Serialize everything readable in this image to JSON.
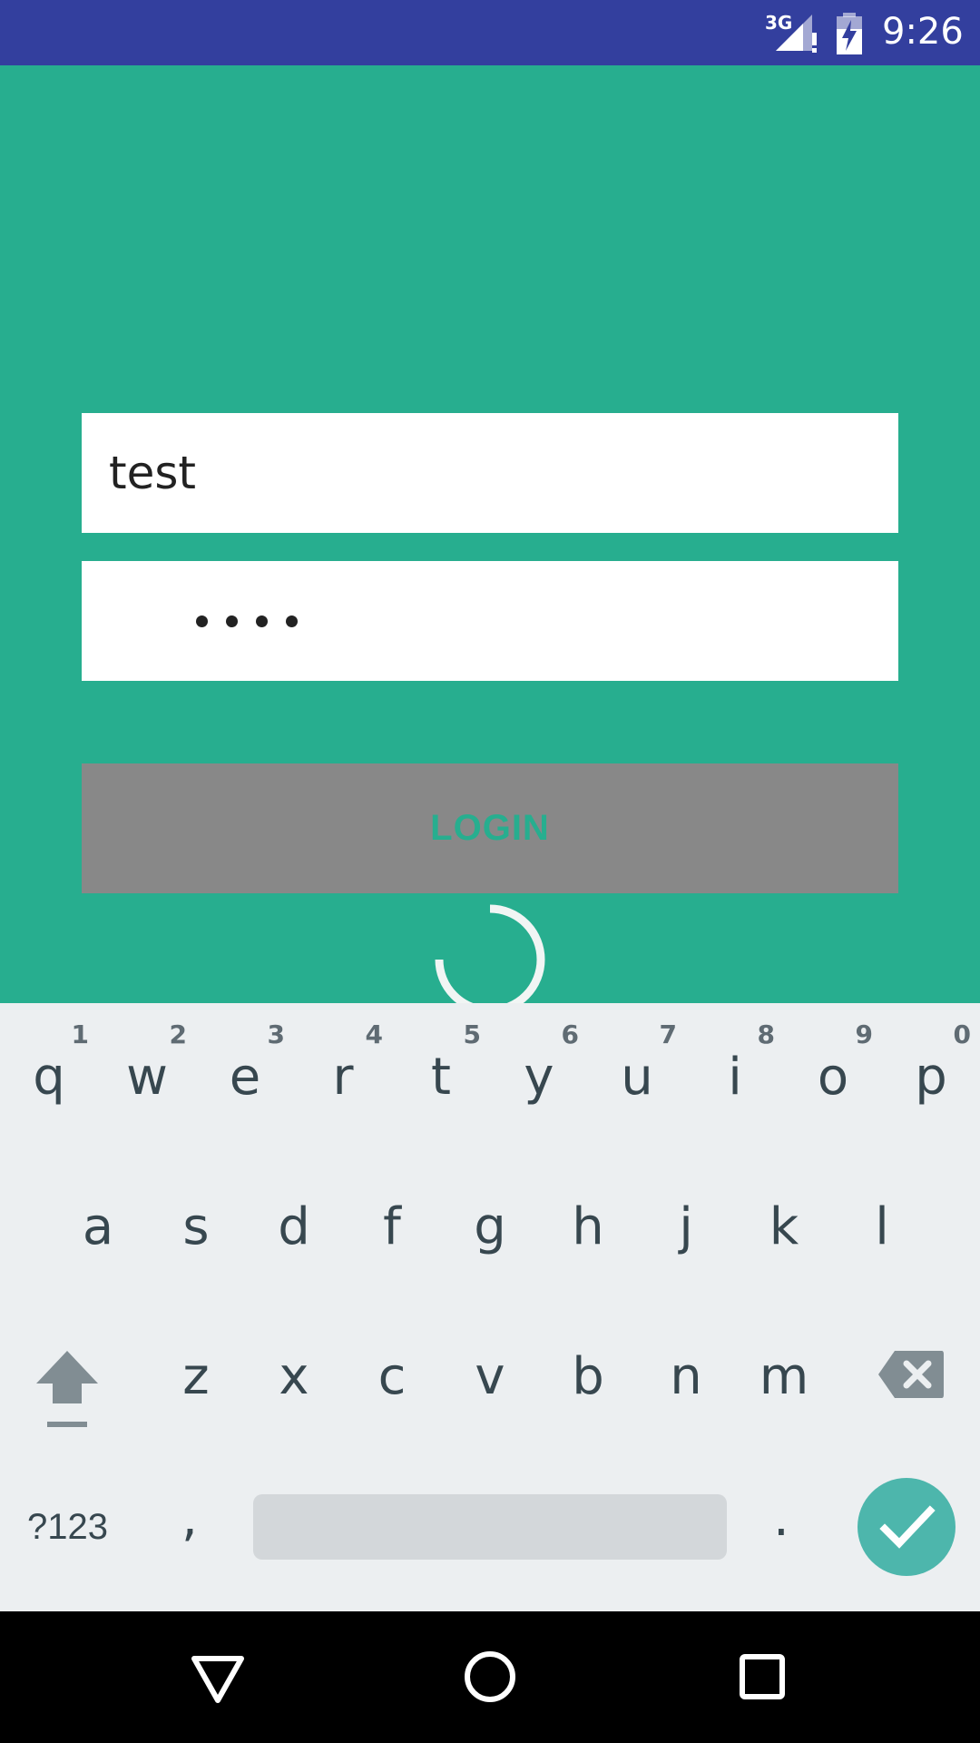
{
  "status_bar": {
    "network": "3G",
    "time": "9:26",
    "colors": {
      "background": "#333F9E",
      "icons": "#FFFFFF"
    },
    "icons": [
      "signal-icon",
      "battery-charging-icon"
    ]
  },
  "login": {
    "username_value": "test",
    "password_mask_count": 4,
    "login_label": "LOGIN",
    "colors": {
      "background": "#27AE8F",
      "button": "#888888",
      "button_text": "#27AE8F",
      "field": "#FFFFFF"
    }
  },
  "loading": {
    "icon": "loading-spinner-icon"
  },
  "keyboard": {
    "row1": [
      {
        "key": "q",
        "hint": "1"
      },
      {
        "key": "w",
        "hint": "2"
      },
      {
        "key": "e",
        "hint": "3"
      },
      {
        "key": "r",
        "hint": "4"
      },
      {
        "key": "t",
        "hint": "5"
      },
      {
        "key": "y",
        "hint": "6"
      },
      {
        "key": "u",
        "hint": "7"
      },
      {
        "key": "i",
        "hint": "8"
      },
      {
        "key": "o",
        "hint": "9"
      },
      {
        "key": "p",
        "hint": "0"
      }
    ],
    "row2": [
      "a",
      "s",
      "d",
      "f",
      "g",
      "h",
      "j",
      "k",
      "l"
    ],
    "row3": [
      "z",
      "x",
      "c",
      "v",
      "b",
      "n",
      "m"
    ],
    "symbols_label": "?123",
    "comma_label": ",",
    "period_label": ".",
    "colors": {
      "background": "#ECEFF1",
      "key_text": "#37474F",
      "space": "#D3D7DA",
      "enter": "#4DB6AC"
    },
    "icons": [
      "shift-icon",
      "backspace-icon",
      "checkmark-icon"
    ]
  },
  "nav_bar": {
    "icons": [
      "back-icon",
      "home-icon",
      "recents-icon"
    ],
    "colors": {
      "background": "#000000"
    }
  }
}
